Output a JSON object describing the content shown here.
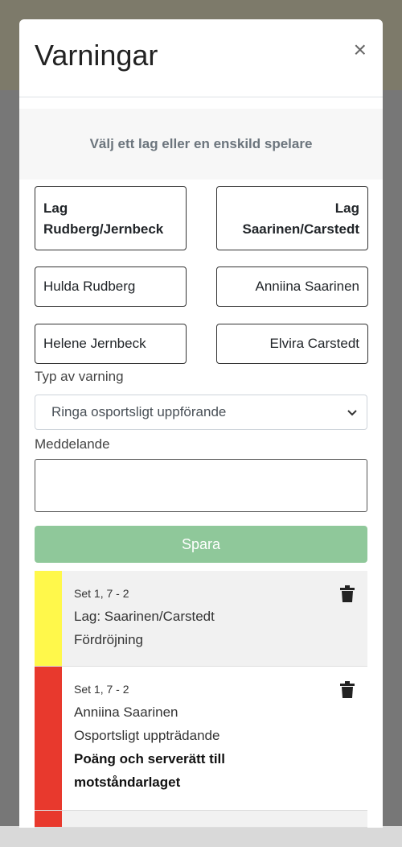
{
  "modal": {
    "title": "Varningar",
    "close": "×"
  },
  "choose_prompt": "Välj ett lag eller en enskild spelare",
  "teams": {
    "left": {
      "line1": "Lag",
      "line2": "Rudberg/Jernbeck"
    },
    "right": {
      "line1": "Lag",
      "line2": "Saarinen/Carstedt"
    }
  },
  "players": {
    "left": [
      "Hulda Rudberg",
      "Helene Jernbeck"
    ],
    "right": [
      "Anniina Saarinen",
      "Elvira Carstedt"
    ]
  },
  "warning_type": {
    "label": "Typ av varning",
    "selected": "Ringa osportsligt uppförande"
  },
  "message": {
    "label": "Meddelande",
    "value": ""
  },
  "save_label": "Spara",
  "warnings": [
    {
      "color": "#fff84b",
      "set": "Set 1, 7 - 2",
      "target": "Lag: Saarinen/Carstedt",
      "reason": "Fördröjning",
      "penalty": ""
    },
    {
      "color": "#e8392d",
      "set": "Set 1, 7 - 2",
      "target": "Anniina Saarinen",
      "reason": "Osportsligt uppträdande",
      "penalty": "Poäng och serverätt till motståndarlaget"
    }
  ],
  "colors": {
    "save": "#8fc89a",
    "yellow_card": "#fff84b",
    "red_card": "#e8392d"
  },
  "icons": {
    "close": "close-icon",
    "chevron": "chevron-down-icon",
    "delete": "trash-icon"
  }
}
